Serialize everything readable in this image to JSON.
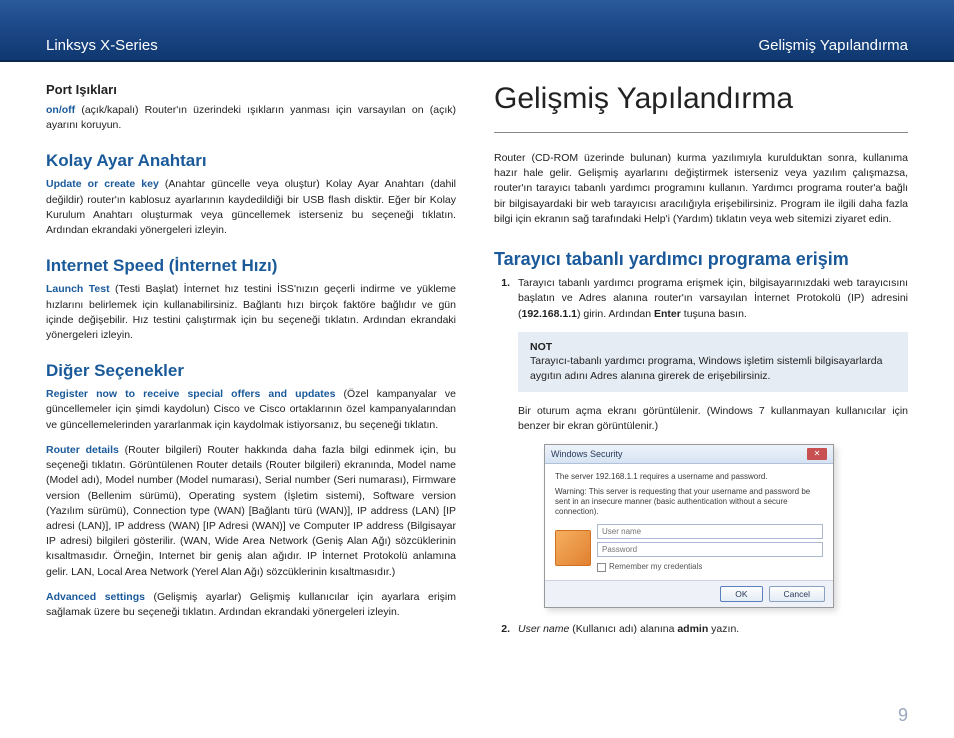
{
  "header": {
    "left": "Linksys X-Series",
    "right": "Gelişmiş Yapılandırma"
  },
  "left": {
    "sec1": {
      "title": "Port Işıkları",
      "p1_bold": "on/off",
      "p1": " (açık/kapalı) Router'ın üzerindeki ışıkların yanması için varsayılan on (açık) ayarını koruyun."
    },
    "sec2": {
      "title": "Kolay Ayar Anahtarı",
      "p1_bold": "Update or create key",
      "p1": " (Anahtar güncelle veya oluştur) Kolay Ayar Anahtarı (dahil değildir) router'ın kablosuz ayarlarının kaydedildiği bir USB flash disktir. Eğer bir Kolay Kurulum Anahtarı oluşturmak veya güncellemek isterseniz bu seçeneği tıklatın. Ardından ekrandaki yönergeleri izleyin."
    },
    "sec3": {
      "title": "Internet Speed (İnternet Hızı)",
      "p1_bold": "Launch Test",
      "p1": " (Testi Başlat) İnternet hız testini İSS'nızın geçerli indirme ve yükleme hızlarını belirlemek için kullanabilirsiniz. Bağlantı hızı birçok faktöre bağlıdır ve gün içinde değişebilir. Hız testini çalıştırmak için bu seçeneği tıklatın. Ardından ekrandaki yönergeleri izleyin."
    },
    "sec4": {
      "title": "Diğer Seçenekler",
      "p1_bold": "Register now to receive special offers and updates",
      "p1": " (Özel kampanyalar ve güncellemeler için şimdi kaydolun) Cisco ve Cisco ortaklarının özel kampanyalarından ve güncellemelerinden yararlanmak için kaydolmak istiyorsanız, bu seçeneği tıklatın.",
      "p2_bold": "Router details",
      "p2": " (Router bilgileri) Router hakkında daha fazla bilgi edinmek için, bu seçeneği tıklatın. Görüntülenen Router details (Router bilgileri) ekranında, Model name (Model adı), Model number (Model numarası), Serial number (Seri numarası), Firmware version (Bellenim sürümü), Operating system (İşletim sistemi), Software version (Yazılım sürümü), Connection type (WAN) [Bağlantı türü (WAN)], IP address (LAN) [IP adresi (LAN)], IP address (WAN) [IP Adresi (WAN)] ve Computer IP address (Bilgisayar IP adresi) bilgileri gösterilir. (WAN, Wide Area Network (Geniş Alan Ağı) sözcüklerinin kısaltmasıdır. Örneğin, Internet bir geniş alan ağıdır. IP İnternet Protokolü anlamına gelir. LAN, Local Area Network (Yerel Alan Ağı) sözcüklerinin kısaltmasıdır.)",
      "p3_bold": "Advanced settings",
      "p3": " (Gelişmiş ayarlar)  Gelişmiş kullanıcılar için ayarlara erişim sağlamak üzere bu seçeneği tıklatın. Ardından ekrandaki yönergeleri izleyin."
    }
  },
  "right": {
    "title": "Gelişmiş Yapılandırma",
    "intro": "Router (CD-ROM üzerinde bulunan) kurma yazılımıyla kurulduktan sonra, kullanıma hazır hale gelir. Gelişmiş ayarlarını değiştirmek isterseniz veya yazılım çalışmazsa, router'ın tarayıcı tabanlı yardımcı programını kullanın. Yardımcı programa router'a bağlı bir bilgisayardaki bir web tarayıcısı aracılığıyla erişebilirsiniz. Program ile ilgili daha fazla bilgi için ekranın sağ tarafındaki Help'i (Yardım) tıklatın veya web sitemizi ziyaret edin.",
    "h2": "Tarayıcı tabanlı yardımcı programa erişim",
    "step1_a": "Tarayıcı tabanlı yardımcı programa erişmek için, bilgisayarınızdaki web tarayıcısını başlatın ve Adres alanına router'ın varsayılan İnternet Protokolü (IP) adresini (",
    "step1_ip": "192.168.1.1",
    "step1_b": ") girin. Ardından ",
    "step1_enter": "Enter",
    "step1_c": " tuşuna basın.",
    "note_label": "NOT",
    "note_body": "Tarayıcı-tabanlı yardımcı programa, Windows işletim sistemli bilgisayarlarda aygıtın adını Adres alanına girerek de erişebilirsiniz.",
    "after_note": "Bir oturum açma ekranı görüntülenir. (Windows 7 kullanmayan kullanıcılar için benzer bir ekran görüntülenir.)",
    "step2_a": "User name",
    "step2_b": " (Kullanıcı adı) alanına ",
    "step2_admin": "admin",
    "step2_c": " yazın."
  },
  "dialog": {
    "title": "Windows Security",
    "line1": "The server 192.168.1.1 requires a username and password.",
    "line2": "Warning: This server is requesting that your username and password be sent in an insecure manner (basic authentication without a secure connection).",
    "user": "User name",
    "pass": "Password",
    "remember": "Remember my credentials",
    "ok": "OK",
    "cancel": "Cancel"
  },
  "pagenum": "9"
}
